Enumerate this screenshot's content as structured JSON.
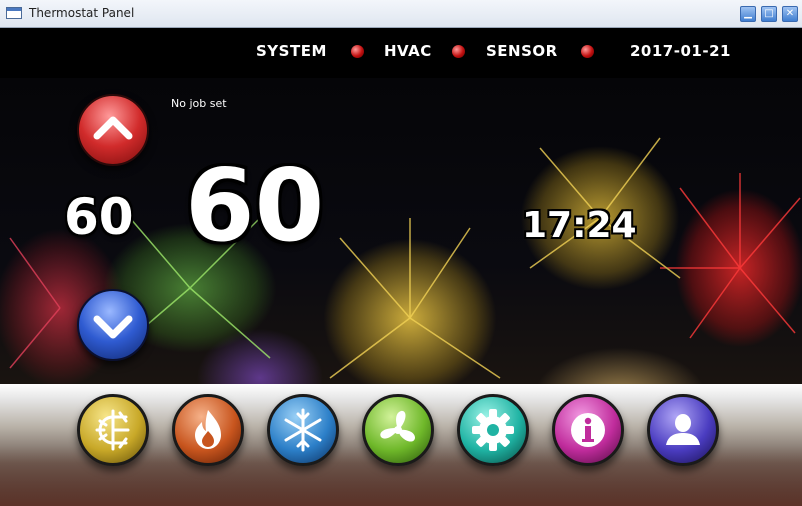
{
  "window": {
    "title": "Thermostat Panel",
    "min": "▁",
    "max": "□",
    "close": "✕"
  },
  "status": {
    "system_label": "SYSTEM",
    "hvac_label": "HVAC",
    "sensor_label": "SENSOR",
    "date": "2017-01-21",
    "led_color": "#c21010"
  },
  "job": "No job set",
  "setpoint": "60",
  "current_temp": "60",
  "time": "17:24",
  "icons": {
    "up": "chevron-up-icon",
    "down": "chevron-down-icon",
    "modes": [
      "auto-icon",
      "flame-icon",
      "snowflake-icon",
      "fan-icon",
      "gear-icon",
      "info-icon",
      "user-icon"
    ]
  },
  "colors": {
    "up": "#d12b2b",
    "down": "#2f5bd1",
    "auto": "#c8a828",
    "heat": "#c8551e",
    "cool": "#2c7fc8",
    "fan": "#6fb82a",
    "settings": "#1fb3a3",
    "info": "#c02c9c",
    "user": "#4a3cc0"
  }
}
